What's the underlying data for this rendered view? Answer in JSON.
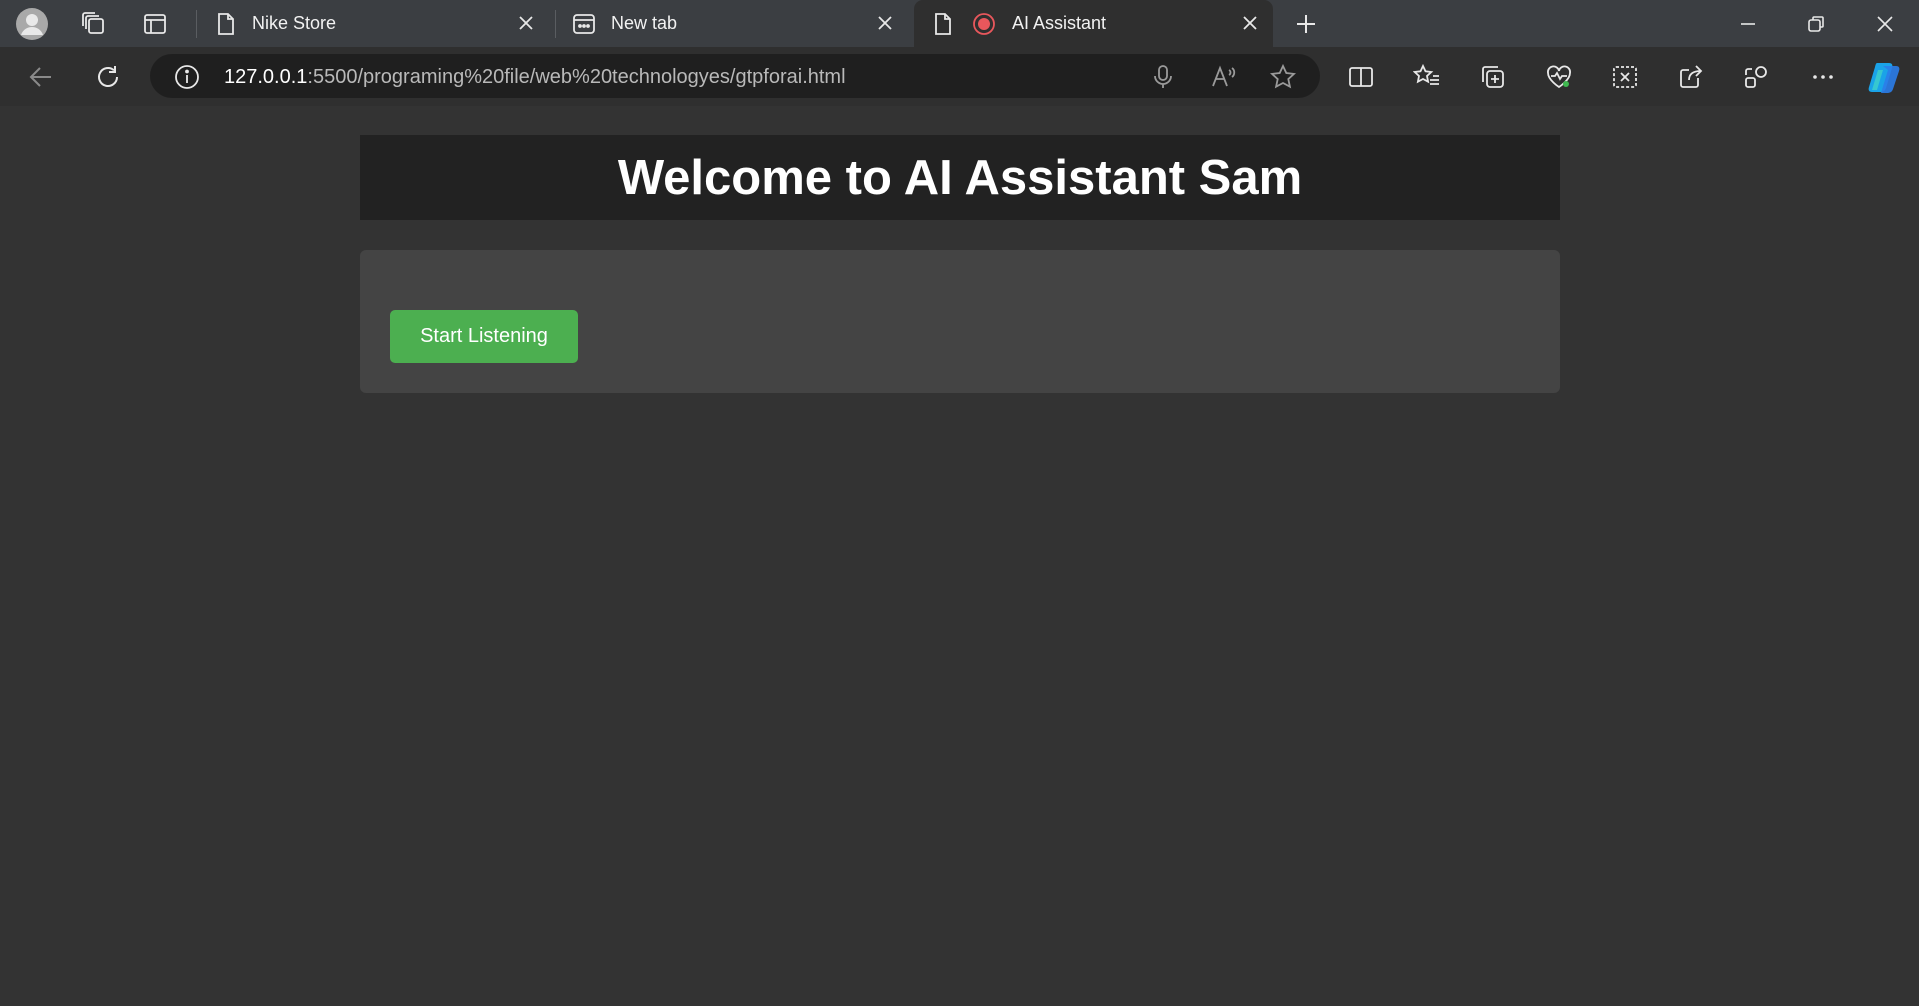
{
  "browser": {
    "tabs": [
      {
        "title": "Nike Store",
        "icon": "page-icon",
        "active": false
      },
      {
        "title": "New tab",
        "icon": "new-tab-icon",
        "active": false
      },
      {
        "title": "AI Assistant",
        "icon": "page-icon",
        "recording": true,
        "active": true
      }
    ],
    "address": {
      "host": "127.0.0.1",
      "rest": ":5500/programing%20file/web%20technologyes/gtpforai.html"
    }
  },
  "page": {
    "title": "Welcome to AI Assistant Sam",
    "button_label": "Start Listening"
  },
  "colors": {
    "page_bg": "#333333",
    "header_bg": "#222222",
    "panel_bg": "#444444",
    "button_bg": "#4caf50",
    "recording_red": "#e8575c"
  }
}
